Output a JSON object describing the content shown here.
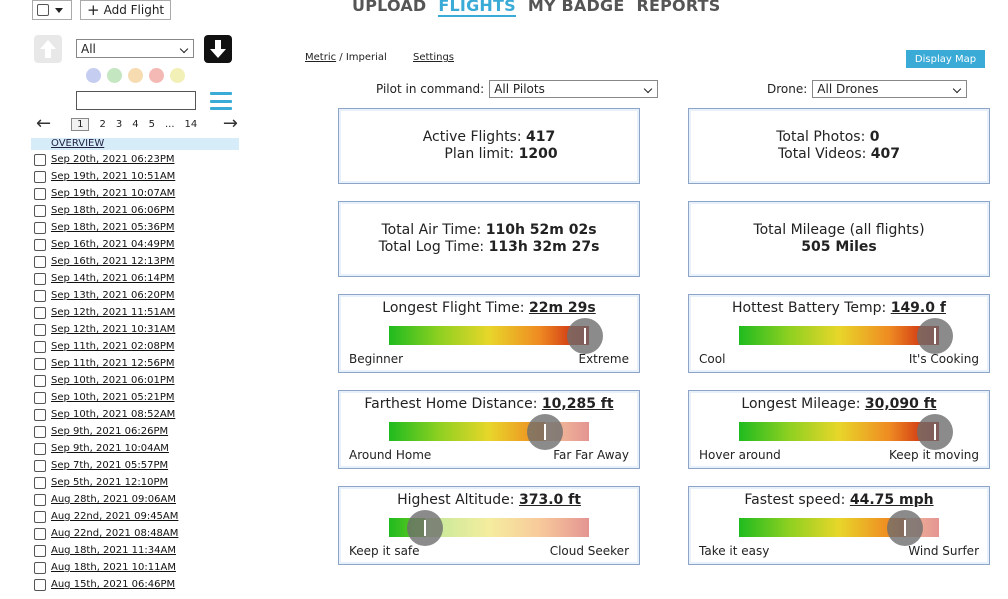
{
  "sidebar": {
    "add_flight_label": "Add Flight",
    "filter_select_value": "All",
    "color_filters": [
      "#c5cdf0",
      "#c4e6c0",
      "#f6dcb0",
      "#f4b9b4",
      "#f2f0b6"
    ],
    "search_value": "",
    "pager": {
      "pages": [
        "1",
        "2",
        "3",
        "4",
        "5",
        "...",
        "14"
      ],
      "current": "1"
    },
    "overview_label": "OVERVIEW",
    "flights": [
      "Sep 20th, 2021 06:23PM",
      "Sep 19th, 2021 10:51AM",
      "Sep 19th, 2021 10:07AM",
      "Sep 18th, 2021 06:06PM",
      "Sep 18th, 2021 05:36PM",
      "Sep 16th, 2021 04:49PM",
      "Sep 16th, 2021 12:13PM",
      "Sep 14th, 2021 06:14PM",
      "Sep 13th, 2021 06:20PM",
      "Sep 12th, 2021 11:51AM",
      "Sep 12th, 2021 10:31AM",
      "Sep 11th, 2021 02:08PM",
      "Sep 11th, 2021 12:56PM",
      "Sep 10th, 2021 06:01PM",
      "Sep 10th, 2021 05:21PM",
      "Sep 10th, 2021 08:52AM",
      "Sep 9th, 2021 06:26PM",
      "Sep 9th, 2021 10:04AM",
      "Sep 7th, 2021 05:57PM",
      "Sep 5th, 2021 12:10PM",
      "Aug 28th, 2021 09:06AM",
      "Aug 22nd, 2021 09:45AM",
      "Aug 22nd, 2021 08:48AM",
      "Aug 18th, 2021 11:34AM",
      "Aug 18th, 2021 10:11AM",
      "Aug 15th, 2021 06:46PM"
    ]
  },
  "nav": {
    "tabs": [
      "UPLOAD",
      "FLIGHTS",
      "MY BADGE",
      "REPORTS"
    ],
    "active": "FLIGHTS"
  },
  "toolbar": {
    "metric_label": "Metric",
    "separator": " / ",
    "imperial_label": "Imperial",
    "settings_label": "Settings",
    "display_map_label": "Display Map"
  },
  "filters": {
    "pilot_label": "Pilot in command:",
    "pilot_value": "All Pilots",
    "drone_label": "Drone:",
    "drone_value": "All Drones"
  },
  "stats": {
    "active_flights_label": "Active Flights:",
    "active_flights_value": "417",
    "plan_limit_label": "Plan limit:",
    "plan_limit_value": "1200",
    "total_photos_label": "Total Photos:",
    "total_photos_value": "0",
    "total_videos_label": "Total Videos:",
    "total_videos_value": "407",
    "air_time_label": "Total Air Time:",
    "air_time_value": "110h 52m 02s",
    "log_time_label": "Total Log Time:",
    "log_time_value": "113h 32m 27s",
    "mileage_label": "Total Mileage (all flights)",
    "mileage_value": "505 Miles"
  },
  "gauges": [
    {
      "title": "Longest Flight Time:",
      "value": "22m 29s",
      "left": "Beginner",
      "right": "Extreme",
      "level": 1.0
    },
    {
      "title": "Hottest Battery Temp:",
      "value": "149.0 f",
      "left": "Cool",
      "right": "It's Cooking",
      "level": 1.0
    },
    {
      "title": "Farthest Home Distance:",
      "value": "10,285 ft",
      "left": "Around Home",
      "right": "Far Far Away",
      "level": 0.78
    },
    {
      "title": "Longest Mileage:",
      "value": "30,090 ft",
      "left": "Hover around",
      "right": "Keep it moving",
      "level": 1.0
    },
    {
      "title": "Highest Altitude:",
      "value": "373.0 ft",
      "left": "Keep it safe",
      "right": "Cloud Seeker",
      "level": 0.18
    },
    {
      "title": "Fastest speed:",
      "value": "44.75 mph",
      "left": "Take it easy",
      "right": "Wind Surfer",
      "level": 0.83
    }
  ]
}
